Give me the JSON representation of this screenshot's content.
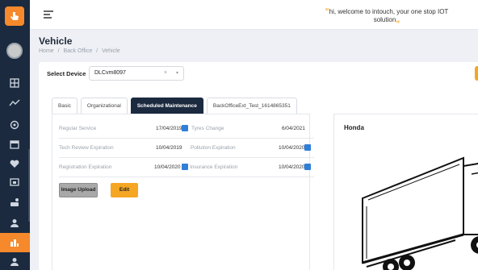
{
  "header": {
    "welcome_line1": "hi, welcome to intouch, your one stop IOT",
    "welcome_line2": "solution"
  },
  "page": {
    "title": "Vehicle",
    "breadcrumb": [
      "Home",
      "/",
      "Back Office",
      "/",
      "Vehicle"
    ]
  },
  "device": {
    "label": "Select Device",
    "value": "DLCvm8097",
    "clear": "×",
    "arrow": "▾"
  },
  "tabs": [
    {
      "label": "Basic",
      "active": false
    },
    {
      "label": "Organizational",
      "active": false
    },
    {
      "label": "Scheduled Maintenance",
      "active": true
    },
    {
      "label": "BackOfficeExt_Test_1614865351",
      "active": false
    }
  ],
  "maintenance": {
    "regular_service_label": "Regular Service",
    "regular_service_value": "17/04/2019",
    "tyres_change_label": "Tyres Change",
    "tyres_change_value": "6/04/2021",
    "tech_review_label": "Tech Review Expiration",
    "tech_review_value": "10/04/2019",
    "pollution_label": "Pollution Expiration",
    "pollution_value": "10/04/2020",
    "registration_label": "Registration Expiration",
    "registration_value": "10/04/2020",
    "insurance_label": "Insurance Expiration",
    "insurance_value": "10/04/2020"
  },
  "buttons": {
    "upload": "Image Upload",
    "edit": "Edit"
  },
  "vehicle_panel": {
    "title": "Honda"
  },
  "colors": {
    "sidebar": "#1b2a3f",
    "accent": "#f5892b",
    "button_orange": "#f5a623",
    "calendar_blue": "#2f7fd9"
  }
}
